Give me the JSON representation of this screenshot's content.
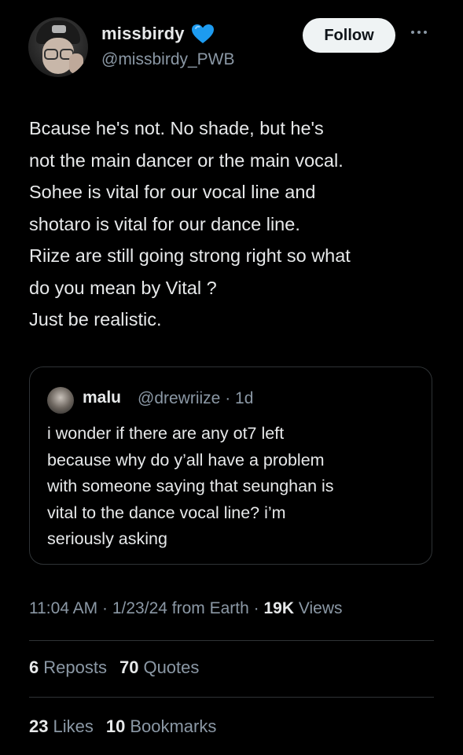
{
  "author": {
    "display_name": "missbirdy",
    "handle": "@missbirdy_PWB",
    "badge_icon": "blue-heart-icon",
    "badge_color": "#1d9bf0",
    "follow_label": "Follow"
  },
  "tweet": {
    "text": "Bcause he's not. No shade, but he's\nnot the main dancer or the main vocal.\nSohee is vital for our vocal line and\nshotaro is vital for our dance line.\nRiize are still going strong right so what\ndo you mean by Vital ?\nJust be realistic."
  },
  "quoted_tweet": {
    "display_name": "malu",
    "handle": "@drewriize",
    "age": "1d",
    "separator": "·",
    "text": "i wonder if there are any ot7 left\nbecause why do y’all have a problem\nwith someone saying that seunghan is\nvital to the dance vocal line? i’m\nseriously asking"
  },
  "meta": {
    "time": "11:04 AM",
    "separator": "·",
    "date": "1/23/24",
    "source": "from Earth",
    "views_count": "19K",
    "views_label": "Views"
  },
  "stats": {
    "reposts_count": "6",
    "reposts_label": "Reposts",
    "quotes_count": "70",
    "quotes_label": "Quotes",
    "likes_count": "23",
    "likes_label": "Likes",
    "bookmarks_count": "10",
    "bookmarks_label": "Bookmarks"
  },
  "colors": {
    "background": "#000000",
    "text_primary": "#e7e9ea",
    "text_secondary": "#8b98a5",
    "divider": "#2f3336",
    "follow_button_bg": "#eff3f4"
  }
}
